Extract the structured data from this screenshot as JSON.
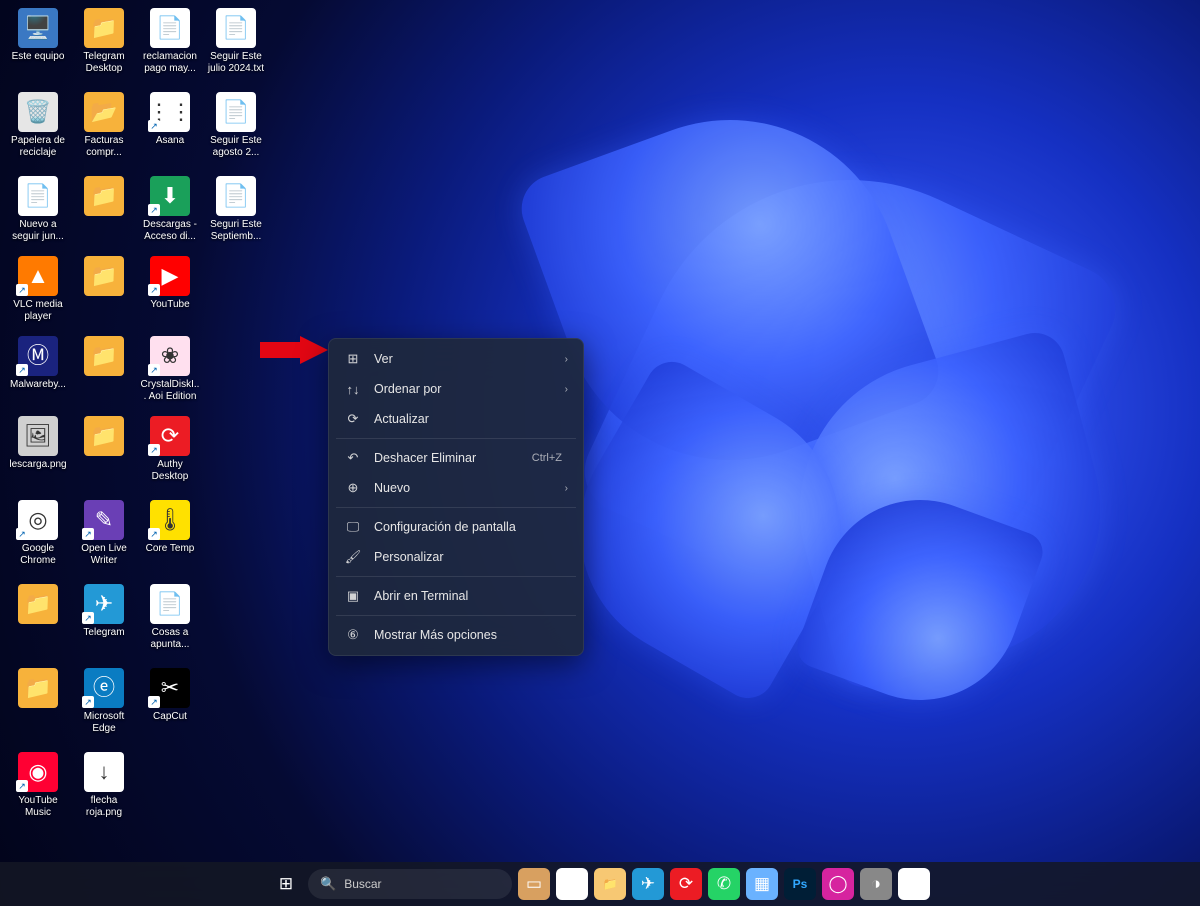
{
  "desktop_icons": [
    {
      "label": "Este equipo",
      "row": 0,
      "col": 0,
      "color": "#3a78c3",
      "glyph": "🖥️",
      "shortcut": false
    },
    {
      "label": "Telegram Desktop",
      "row": 0,
      "col": 1,
      "color": "#f7b23b",
      "glyph": "📁",
      "shortcut": false
    },
    {
      "label": "reclamacion pago may...",
      "row": 0,
      "col": 2,
      "color": "#ffffff",
      "glyph": "📄",
      "shortcut": false
    },
    {
      "label": "Seguir Este julio 2024.txt",
      "row": 0,
      "col": 3,
      "color": "#ffffff",
      "glyph": "📄",
      "shortcut": false
    },
    {
      "label": "Papelera de reciclaje",
      "row": 1,
      "col": 0,
      "color": "#e6e6e6",
      "glyph": "🗑️",
      "shortcut": false
    },
    {
      "label": "Facturas compr...",
      "row": 1,
      "col": 1,
      "color": "#f7b23b",
      "glyph": "📂",
      "shortcut": false
    },
    {
      "label": "Asana",
      "row": 1,
      "col": 2,
      "color": "#ffffff",
      "glyph": "⋮⋮",
      "shortcut": true
    },
    {
      "label": "Seguir Este agosto 2...",
      "row": 1,
      "col": 3,
      "color": "#ffffff",
      "glyph": "📄",
      "shortcut": false
    },
    {
      "label": "Nuevo a seguir jun...",
      "row": 2,
      "col": 0,
      "color": "#ffffff",
      "glyph": "📄",
      "shortcut": false
    },
    {
      "label": "",
      "row": 2,
      "col": 1,
      "color": "#f7b23b",
      "glyph": "📁",
      "shortcut": false,
      "blur": true
    },
    {
      "label": "Descargas - Acceso di...",
      "row": 2,
      "col": 2,
      "color": "#1aa05a",
      "glyph": "⬇",
      "shortcut": true
    },
    {
      "label": "Seguri Este Septiemb...",
      "row": 2,
      "col": 3,
      "color": "#ffffff",
      "glyph": "📄",
      "shortcut": false
    },
    {
      "label": "VLC media player",
      "row": 3,
      "col": 0,
      "color": "#ff7a00",
      "glyph": "▲",
      "shortcut": true
    },
    {
      "label": "",
      "row": 3,
      "col": 1,
      "color": "#f7b23b",
      "glyph": "📁",
      "shortcut": false,
      "blur": true
    },
    {
      "label": "YouTube",
      "row": 3,
      "col": 2,
      "color": "#ff0000",
      "glyph": "▶",
      "shortcut": true
    },
    {
      "label": "Malwareby...",
      "row": 4,
      "col": 0,
      "color": "#1a237e",
      "glyph": "Ⓜ",
      "shortcut": true
    },
    {
      "label": "",
      "row": 4,
      "col": 1,
      "color": "#f7b23b",
      "glyph": "📁",
      "shortcut": false,
      "blur": true
    },
    {
      "label": "CrystalDiskI... Aoi Edition",
      "row": 4,
      "col": 2,
      "color": "#ffe0ef",
      "glyph": "❀",
      "shortcut": true
    },
    {
      "label": "lescarga.png",
      "row": 5,
      "col": 0,
      "color": "#d0d0d0",
      "glyph": "🖼",
      "shortcut": false
    },
    {
      "label": "",
      "row": 5,
      "col": 1,
      "color": "#f7b23b",
      "glyph": "📁",
      "shortcut": false,
      "blur": true
    },
    {
      "label": "Authy Desktop",
      "row": 5,
      "col": 2,
      "color": "#ec1c24",
      "glyph": "⟳",
      "shortcut": true
    },
    {
      "label": "Google Chrome",
      "row": 6,
      "col": 0,
      "color": "#ffffff",
      "glyph": "◎",
      "shortcut": true
    },
    {
      "label": "Open Live Writer",
      "row": 6,
      "col": 1,
      "color": "#6a3fb5",
      "glyph": "✎",
      "shortcut": true
    },
    {
      "label": "Core Temp",
      "row": 6,
      "col": 2,
      "color": "#ffe100",
      "glyph": "🌡",
      "shortcut": true
    },
    {
      "label": "",
      "row": 7,
      "col": 0,
      "color": "#f7b23b",
      "glyph": "📁",
      "shortcut": false,
      "blur": true
    },
    {
      "label": "Telegram",
      "row": 7,
      "col": 1,
      "color": "#2399d6",
      "glyph": "✈",
      "shortcut": true
    },
    {
      "label": "Cosas a apunta...",
      "row": 7,
      "col": 2,
      "color": "#ffffff",
      "glyph": "📄",
      "shortcut": false
    },
    {
      "label": "",
      "row": 8,
      "col": 0,
      "color": "#f7b23b",
      "glyph": "📁",
      "shortcut": false,
      "blur": true
    },
    {
      "label": "Microsoft Edge",
      "row": 8,
      "col": 1,
      "color": "#0a7cc2",
      "glyph": "ⓔ",
      "shortcut": true
    },
    {
      "label": "CapCut",
      "row": 8,
      "col": 2,
      "color": "#000000",
      "glyph": "✂",
      "shortcut": true
    },
    {
      "label": "YouTube Music",
      "row": 9,
      "col": 0,
      "color": "#ff0033",
      "glyph": "◉",
      "shortcut": true
    },
    {
      "label": "flecha roja.png",
      "row": 9,
      "col": 1,
      "color": "#ffffff",
      "glyph": "↓",
      "shortcut": false
    }
  ],
  "context_menu": {
    "groups": [
      [
        {
          "icon": "⊞",
          "label": "Ver",
          "accel": "",
          "submenu": true,
          "name": "view"
        },
        {
          "icon": "↑↓",
          "label": "Ordenar por",
          "accel": "",
          "submenu": true,
          "name": "sort-by"
        },
        {
          "icon": "⟳",
          "label": "Actualizar",
          "accel": "",
          "submenu": false,
          "name": "refresh"
        }
      ],
      [
        {
          "icon": "↶",
          "label": "Deshacer Eliminar",
          "accel": "Ctrl+Z",
          "submenu": false,
          "name": "undo-delete"
        },
        {
          "icon": "⊕",
          "label": "Nuevo",
          "accel": "",
          "submenu": true,
          "name": "new"
        }
      ],
      [
        {
          "icon": "🖵",
          "label": "Configuración de pantalla",
          "accel": "",
          "submenu": false,
          "name": "display-settings"
        },
        {
          "icon": "🖌",
          "label": "Personalizar",
          "accel": "",
          "submenu": false,
          "name": "personalize"
        }
      ],
      [
        {
          "icon": "▣",
          "label": "Abrir en Terminal",
          "accel": "",
          "submenu": false,
          "name": "open-terminal"
        }
      ],
      [
        {
          "icon": "⑥",
          "label": "Mostrar Más opciones",
          "accel": "",
          "submenu": false,
          "name": "more-options"
        }
      ]
    ]
  },
  "taskbar": {
    "search_placeholder": "Buscar",
    "items": [
      {
        "name": "start",
        "glyph": "⊞",
        "color": "#4cc2ff"
      },
      {
        "name": "search",
        "glyph": "",
        "color": ""
      },
      {
        "name": "taskview",
        "glyph": "▭",
        "color": "#d8a060"
      },
      {
        "name": "chrome",
        "glyph": "◎",
        "color": "#ffffff"
      },
      {
        "name": "explorer",
        "glyph": "📁",
        "color": "#f7c873"
      },
      {
        "name": "telegram",
        "glyph": "✈",
        "color": "#2399d6"
      },
      {
        "name": "authy",
        "glyph": "⟳",
        "color": "#ec1c24"
      },
      {
        "name": "whatsapp",
        "glyph": "✆",
        "color": "#25d366"
      },
      {
        "name": "widgets",
        "glyph": "▦",
        "color": "#6ab2ff"
      },
      {
        "name": "photoshop",
        "glyph": "Ps",
        "color": "#001e36"
      },
      {
        "name": "instagram",
        "glyph": "◯",
        "color": "#d6249f"
      },
      {
        "name": "app1",
        "glyph": "◑",
        "color": "#888888"
      },
      {
        "name": "app2",
        "glyph": "▤",
        "color": "#ffffff"
      }
    ]
  },
  "annotation": {
    "type": "red-arrow",
    "target": "context-menu-view"
  }
}
